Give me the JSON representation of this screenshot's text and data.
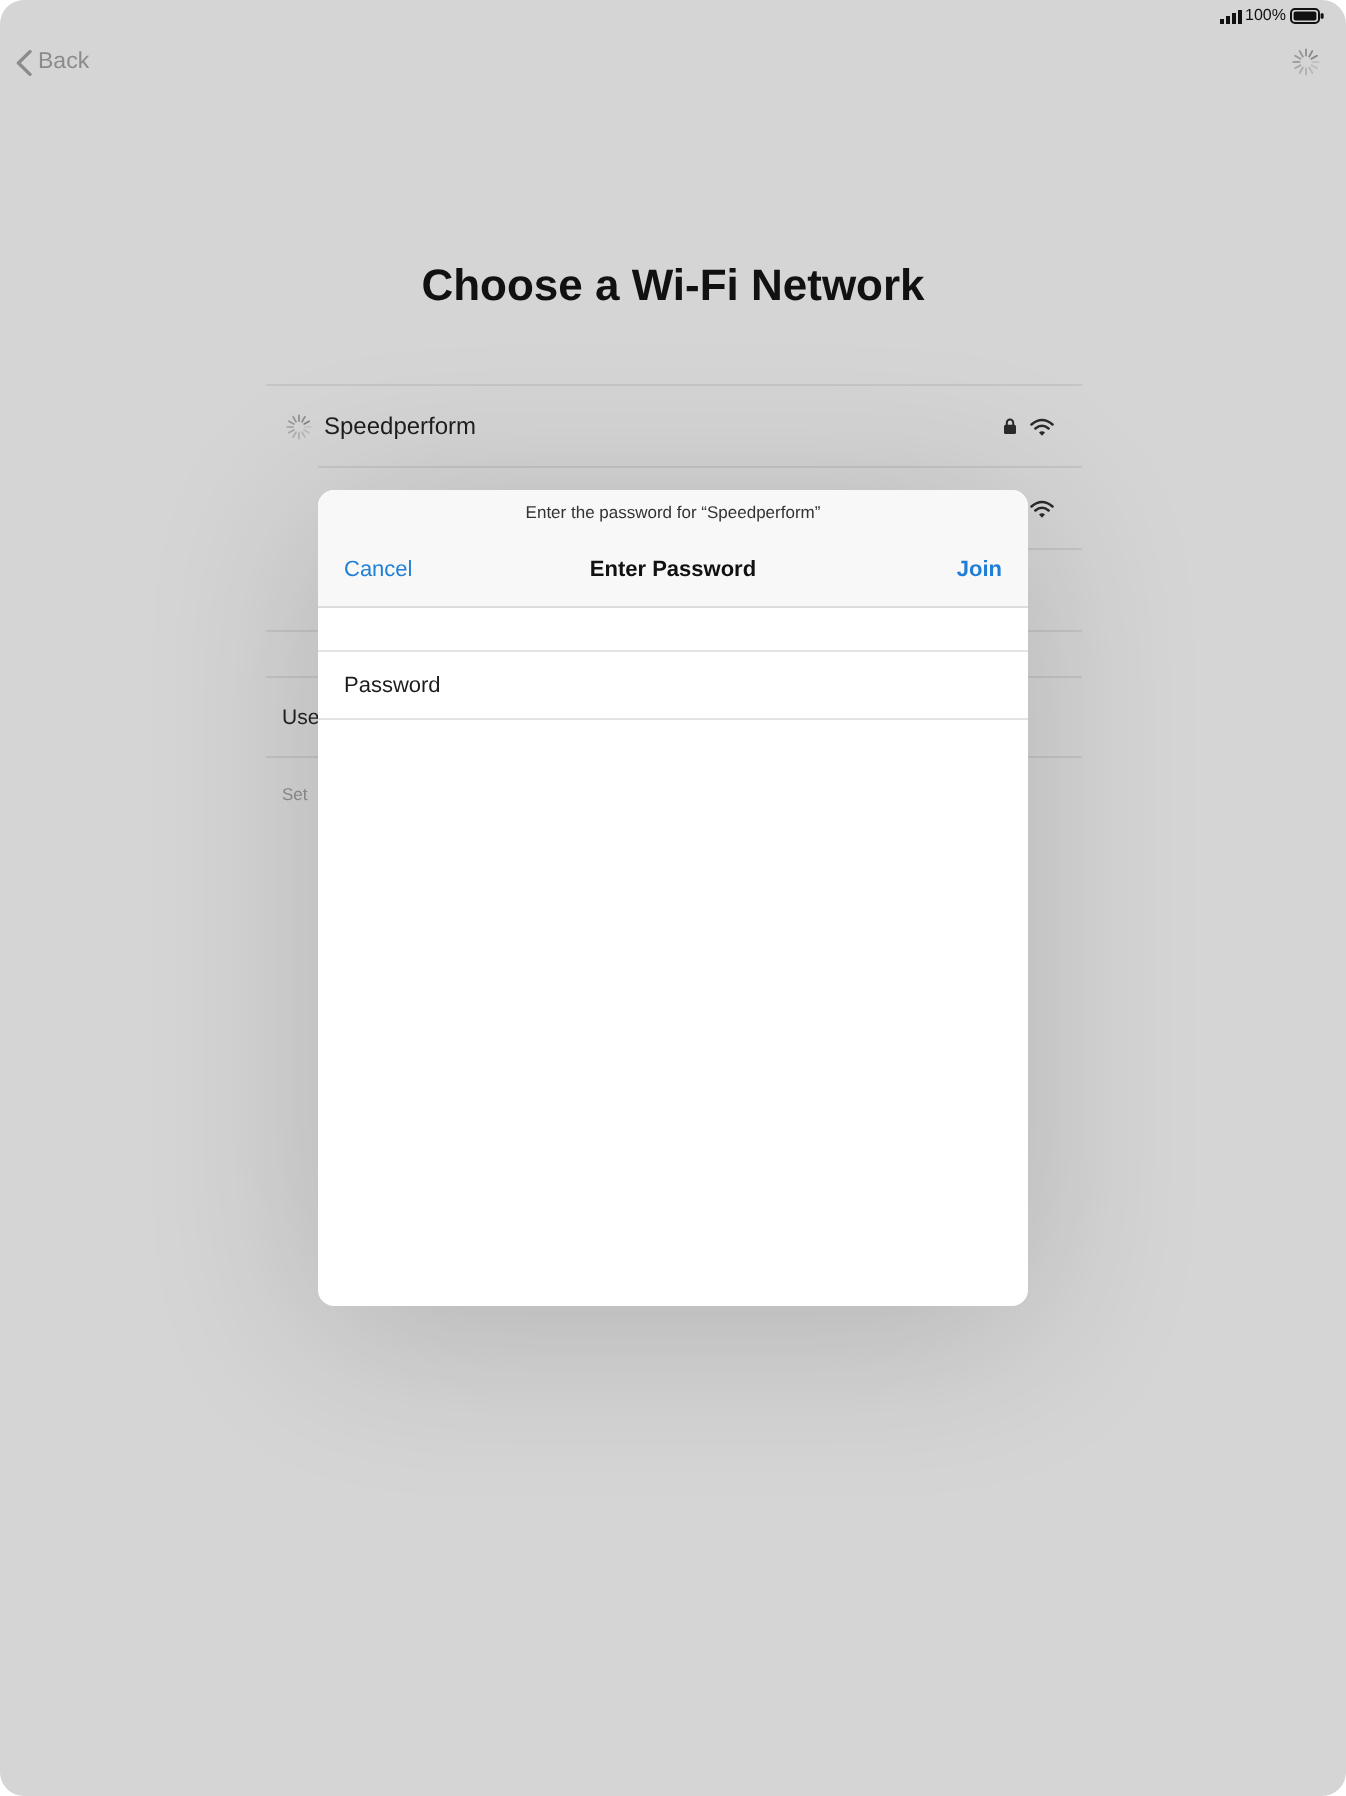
{
  "status_bar": {
    "battery": "100%"
  },
  "nav": {
    "back": "Back",
    "loading": true
  },
  "title": "Choose a Wi-Fi Network",
  "networks": [
    {
      "name": "Speedperform",
      "connecting": true,
      "locked": true
    },
    {
      "connecting": false
    }
  ],
  "settings": {
    "label": "Use",
    "footer": "Set"
  },
  "dialog": {
    "prompt": "Enter the password for “Speedperform”",
    "cancel": "Cancel",
    "title": "Enter Password",
    "join": "Join",
    "fields": [
      {
        "label": "Password"
      }
    ]
  }
}
